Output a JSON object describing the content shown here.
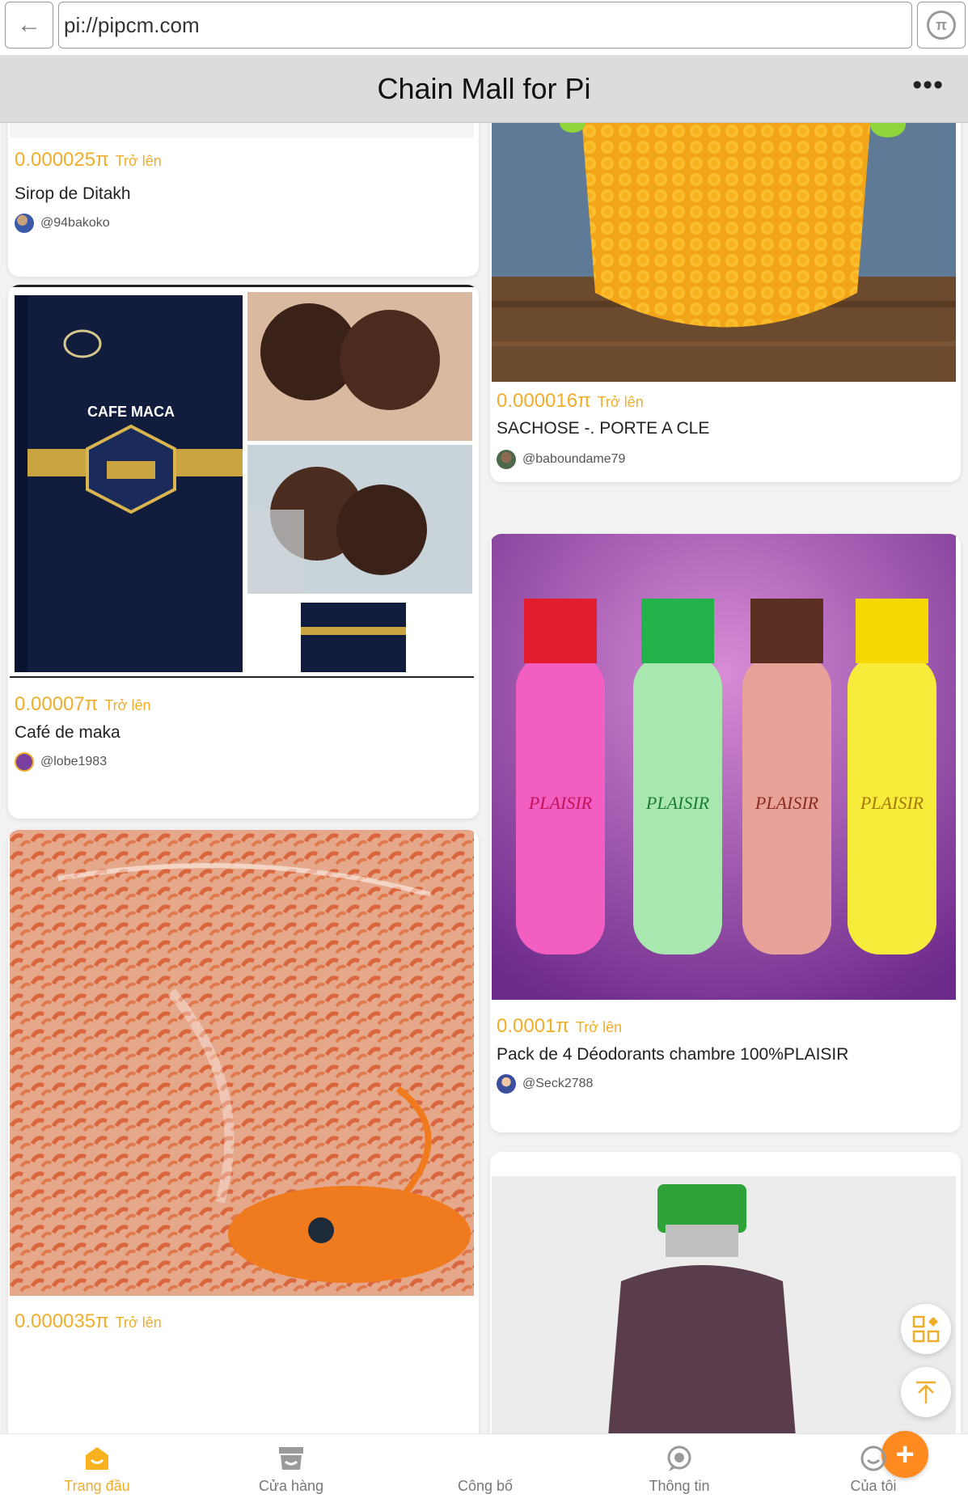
{
  "browser": {
    "url": "pi://pipcm.com",
    "back_icon": "arrow-left-icon",
    "pi_icon": "pi-coin-icon"
  },
  "app": {
    "title": "Chain Mall for Pi",
    "more_label": "•••"
  },
  "price_suffix": "Trở lên",
  "products": [
    {
      "price": "0.000025π",
      "name": "Sirop de Ditakh",
      "seller": "@94bakoko"
    },
    {
      "price": "0.000016π",
      "name": "SACHOSE -. PORTE A CLE",
      "seller": "@baboundame79"
    },
    {
      "price": "0.00007π",
      "name": "Café de maka",
      "seller": "@lobe1983"
    },
    {
      "price": "0.0001π",
      "name": "Pack de 4 Déodorants chambre 100%PLAISIR",
      "seller": "@Seck2788"
    },
    {
      "price": "0.000035π",
      "name": "",
      "seller": ""
    }
  ],
  "product_images": {
    "maca_box": "CAFE MACA",
    "deodorant_label": "PLAISIR"
  },
  "floating": {
    "categories_icon": "grid-icon",
    "top_icon": "arrow-up-to-top-icon"
  },
  "tabbar": {
    "items": [
      {
        "label": "Trang đầu",
        "icon": "home-face-icon"
      },
      {
        "label": "Cửa hàng",
        "icon": "store-icon"
      },
      {
        "label": "Công bố",
        "icon": "plus-icon"
      },
      {
        "label": "Thông tin",
        "icon": "message-icon"
      },
      {
        "label": "Của tôi",
        "icon": "profile-icon"
      }
    ],
    "publish_symbol": "+"
  },
  "colors": {
    "accent": "#f0ad2a",
    "publish": "#ff8a1f",
    "appbar": "#dcdcdc"
  }
}
